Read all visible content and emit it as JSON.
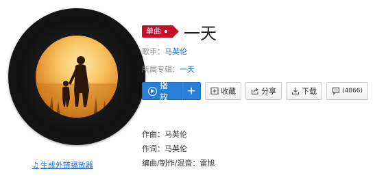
{
  "song": {
    "badge_label": "单曲",
    "title": "一天"
  },
  "info": {
    "singer_label": "歌手：",
    "singer": "马英伦",
    "album_label": "所属专辑：",
    "album": "一天"
  },
  "actions": {
    "play_label": "播放",
    "add_label": "+",
    "favorite_label": "收藏",
    "share_label": "分享",
    "download_label": "下载",
    "comment_count": "(4866)"
  },
  "credits": {
    "composer": "作曲：马英伦",
    "lyricist": "作词：马英伦",
    "arranger": "编曲/制作/混音：雷旭"
  },
  "generate_link": {
    "label": "生成外链播放器"
  },
  "colors": {
    "accent_blue": "#2a80d8",
    "badge_red": "#c4102b",
    "link_blue": "#1f6ed4"
  }
}
